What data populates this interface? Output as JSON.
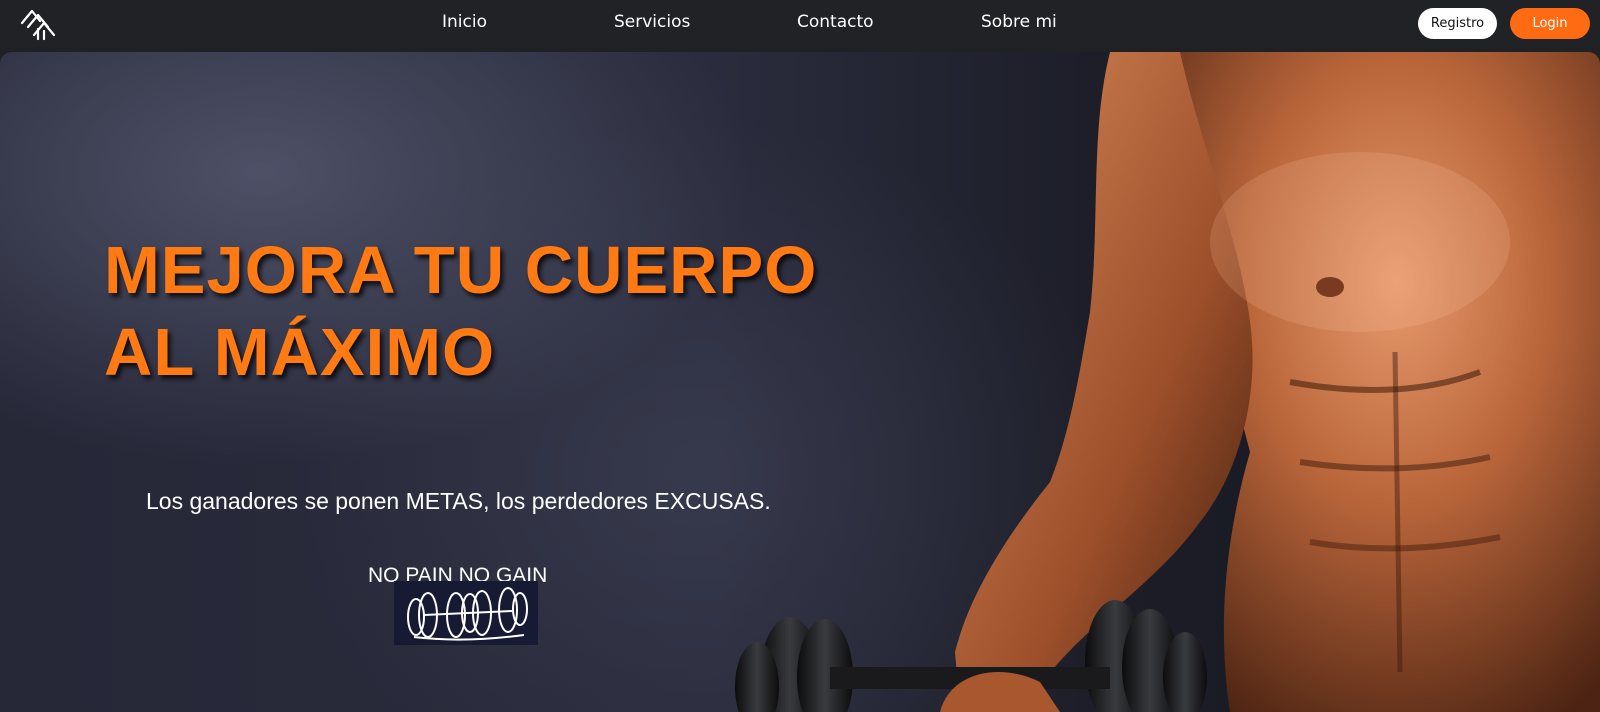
{
  "navbar": {
    "logo": "gym-monogram-logo",
    "links": [
      "Inicio",
      "Servicios",
      "Contacto",
      "Sobre mi"
    ],
    "register_label": "Registro",
    "login_label": "Login"
  },
  "hero": {
    "headline_line1": "MEJORA TU CUERPO",
    "headline_line2": "AL MÁXIMO",
    "quote": "Los ganadores se ponen METAS, los perdedores EXCUSAS.",
    "motto": "NO PAIN NO GAIN",
    "badge_icon": "dumbbell-icon",
    "background_image": "muscular-man-with-dumbbells"
  },
  "colors": {
    "accent": "#fe6b12",
    "headline": "#ff7a12",
    "navbar": "#202226"
  }
}
